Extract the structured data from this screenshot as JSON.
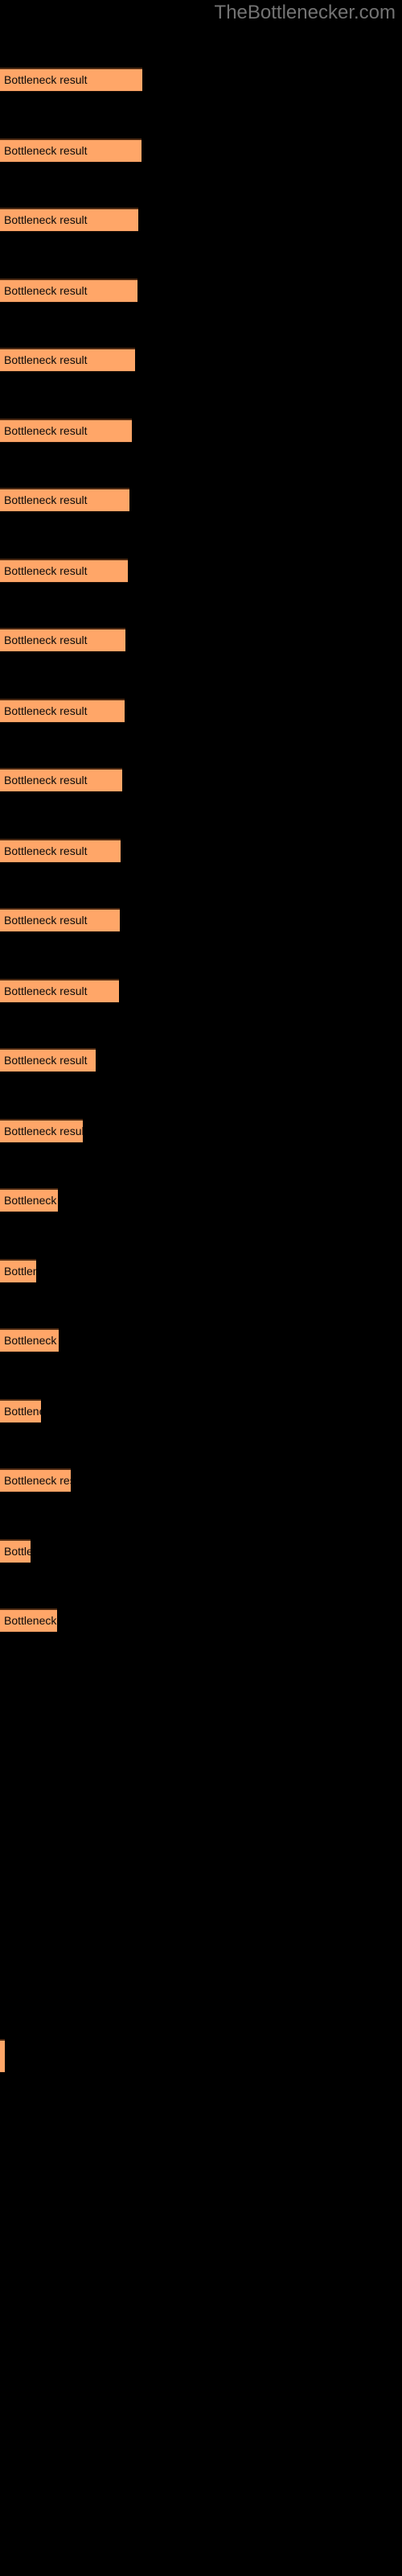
{
  "watermark": "TheBottlenecker.com",
  "background_color": "#000000",
  "bar_color": "#FFA668",
  "bar_border_color": "#4d2a12",
  "label_color": "#0a0a0a",
  "watermark_color": "#737373",
  "bar_label": "Bottleneck result",
  "chart_data": {
    "type": "bar",
    "orientation": "horizontal",
    "title": "",
    "subtitle": "",
    "xlabel": "",
    "ylabel": "",
    "grid": false,
    "legend": null,
    "categories": [
      "Bottleneck result",
      "Bottleneck result",
      "Bottleneck result",
      "Bottleneck result",
      "Bottleneck result",
      "Bottleneck result",
      "Bottleneck result",
      "Bottleneck result",
      "Bottleneck result",
      "Bottleneck result",
      "Bottleneck result",
      "Bottleneck result",
      "Bottleneck result",
      "Bottleneck result",
      "Bottleneck result",
      "Bottleneck result",
      "Bottleneck result",
      "Bottleneck result",
      "Bottleneck result",
      "Bottleneck result",
      "Bottleneck result",
      "Bottleneck result",
      "Bottleneck result"
    ],
    "values": [
      177,
      176,
      172,
      171,
      168,
      164,
      161,
      159,
      156,
      155,
      152,
      150,
      149,
      148,
      119,
      103,
      72,
      45,
      73,
      51,
      88,
      38,
      71
    ],
    "tiny_value": 10,
    "xlim": [
      0,
      500
    ],
    "bar_count": 23
  },
  "bars": [
    {
      "label": "Bottleneck result",
      "width": 177,
      "top": 57
    },
    {
      "label": "Bottleneck result",
      "width": 176,
      "top": 101
    },
    {
      "label": "Bottleneck result",
      "width": 172,
      "top": 144
    },
    {
      "label": "Bottleneck result",
      "width": 171,
      "top": 188
    },
    {
      "label": "Bottleneck result",
      "width": 168,
      "top": 231
    },
    {
      "label": "Bottleneck result",
      "width": 164,
      "top": 275
    },
    {
      "label": "Bottleneck result",
      "width": 161,
      "top": 318
    },
    {
      "label": "Bottleneck result",
      "width": 159,
      "top": 362
    },
    {
      "label": "Bottleneck result",
      "width": 156,
      "top": 405
    },
    {
      "label": "Bottleneck result",
      "width": 155,
      "top": 449
    },
    {
      "label": "Bottleneck result",
      "width": 152,
      "top": 492
    },
    {
      "label": "Bottleneck result",
      "width": 150,
      "top": 536
    },
    {
      "label": "Bottleneck result",
      "width": 149,
      "top": 579
    },
    {
      "label": "Bottleneck result",
      "width": 148,
      "top": 623
    },
    {
      "label": "Bottleneck result",
      "width": 119,
      "top": 666
    },
    {
      "label": "Bottleneck result",
      "width": 103,
      "top": 710
    },
    {
      "label": "Bottleneck result",
      "width": 72,
      "top": 753
    },
    {
      "label": "Bottleneck result",
      "width": 45,
      "top": 797
    },
    {
      "label": "Bottleneck result",
      "width": 73,
      "top": 840
    },
    {
      "label": "Bottleneck result",
      "width": 51,
      "top": 884
    },
    {
      "label": "Bottleneck result",
      "width": 88,
      "top": 927
    },
    {
      "label": "Bottleneck result",
      "width": 38,
      "top": 971
    },
    {
      "label": "Bottleneck result",
      "width": 71,
      "top": 1014
    }
  ],
  "tiny_bar": {
    "top": 2533,
    "width": 6,
    "height": 42
  }
}
